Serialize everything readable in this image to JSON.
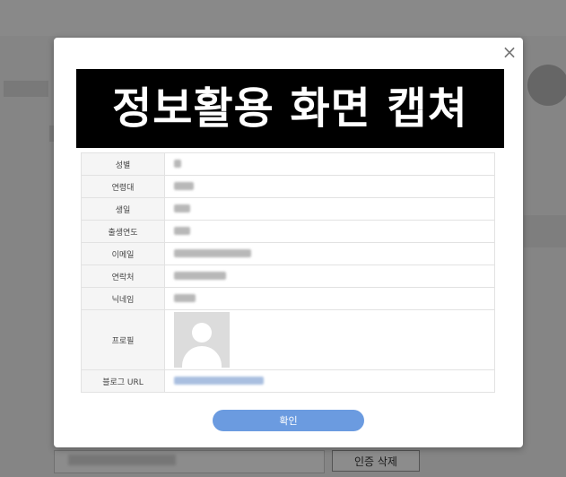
{
  "background": {
    "verify_delete_label": "인증 삭제"
  },
  "banner": {
    "text": "정보활용 화면 캡쳐"
  },
  "modal": {
    "close_glyph": "×",
    "rows": [
      {
        "label": "성별",
        "blur_width": 8
      },
      {
        "label": "연령대",
        "blur_width": 22
      },
      {
        "label": "생일",
        "blur_width": 18
      },
      {
        "label": "출생연도",
        "blur_width": 18
      },
      {
        "label": "이메일",
        "blur_width": 86
      },
      {
        "label": "연락처",
        "blur_width": 58
      },
      {
        "label": "닉네임",
        "blur_width": 24
      },
      {
        "label": "프로필",
        "type": "image"
      },
      {
        "label": "블로그 URL",
        "blur_width": 100,
        "type": "link"
      }
    ],
    "confirm_label": "확인"
  },
  "colors": {
    "confirm_button": "#6b9be0",
    "banner_bg": "#000000",
    "banner_text": "#ffffff"
  }
}
